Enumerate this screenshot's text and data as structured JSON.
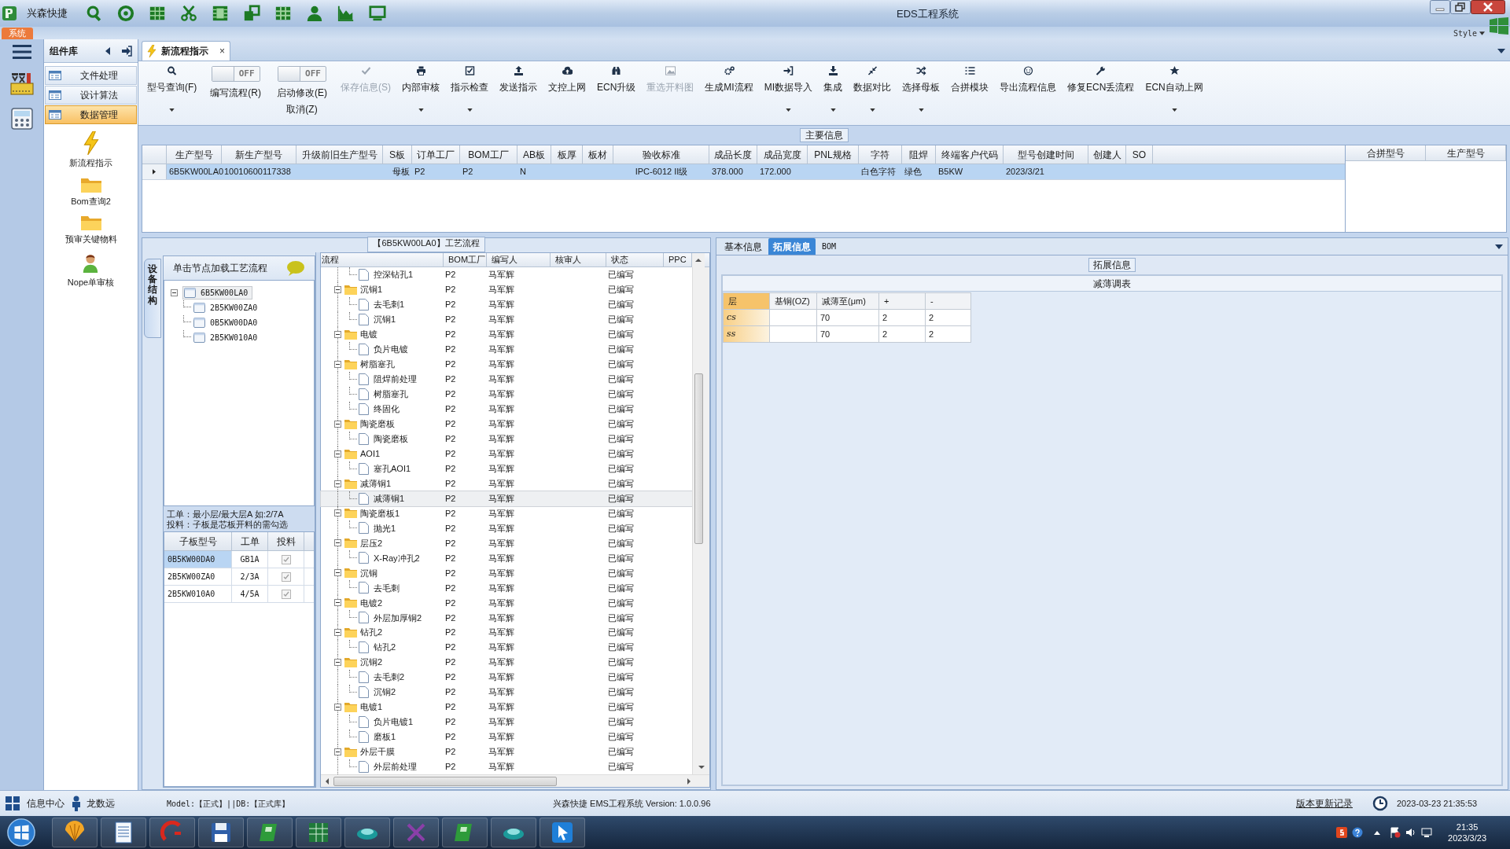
{
  "window": {
    "app_name": "兴森快捷",
    "title": "EDS工程系统",
    "ribbon_tab": "系统",
    "style_menu": "Style"
  },
  "sidebar": {
    "title": "组件库",
    "items": [
      {
        "label": "文件处理",
        "selected": false
      },
      {
        "label": "设计算法",
        "selected": false
      },
      {
        "label": "数据管理",
        "selected": true
      }
    ],
    "launchers": [
      {
        "label": "新流程指示",
        "kind": "lightning"
      },
      {
        "label": "Bom查询2",
        "kind": "folder"
      },
      {
        "label": "预审关键物料",
        "kind": "folder"
      },
      {
        "label": "Nope单审核",
        "kind": "person"
      }
    ]
  },
  "document_tabs": [
    {
      "label": "新流程指示",
      "close": "×",
      "selected": true
    }
  ],
  "toolbar": [
    {
      "kind": "button",
      "label": "型号查询(F)",
      "disabled": false,
      "dropdown": true
    },
    {
      "kind": "toggle",
      "label": "编写流程(R)",
      "toggle_text": "OFF",
      "on": false
    },
    {
      "kind": "toggle",
      "label": "启动修改(E)",
      "label_2": "取消(Z)",
      "toggle_text": "OFF",
      "on": false
    },
    {
      "kind": "button",
      "label": "保存信息(S)",
      "disabled": true,
      "dropdown": false
    },
    {
      "kind": "button",
      "label": "内部审核",
      "disabled": false,
      "dropdown": true
    },
    {
      "kind": "button",
      "label": "指示检查",
      "disabled": false,
      "dropdown": true
    },
    {
      "kind": "button",
      "label": "发送指示",
      "disabled": false,
      "dropdown": false
    },
    {
      "kind": "button",
      "label": "文控上网",
      "disabled": false,
      "dropdown": false
    },
    {
      "kind": "button",
      "label": "ECN升级",
      "disabled": false,
      "dropdown": false
    },
    {
      "kind": "button",
      "label": "重选开料图",
      "disabled": true,
      "dropdown": false
    },
    {
      "kind": "button",
      "label": "生成MI流程",
      "disabled": false,
      "dropdown": false
    },
    {
      "kind": "button",
      "label": "MI数据导入",
      "disabled": false,
      "dropdown": true
    },
    {
      "kind": "button",
      "label": "集成",
      "disabled": false,
      "dropdown": true
    },
    {
      "kind": "button",
      "label": "数据对比",
      "disabled": false,
      "dropdown": true
    },
    {
      "kind": "button",
      "label": "选择母板",
      "disabled": false,
      "dropdown": true
    },
    {
      "kind": "button",
      "label": "合拼模块",
      "disabled": false,
      "dropdown": false
    },
    {
      "kind": "button",
      "label": "导出流程信息",
      "disabled": false,
      "dropdown": false
    },
    {
      "kind": "button",
      "label": "修复ECN丢流程",
      "disabled": false,
      "dropdown": false
    },
    {
      "kind": "button",
      "label": "ECN自动上网",
      "disabled": false,
      "dropdown": true
    }
  ],
  "main_info": {
    "title": "主要信息",
    "columns": [
      "生产型号",
      "新生产型号",
      "升级前旧生产型号",
      "S板",
      "订单工厂",
      "BOM工厂",
      "AB板",
      "板厚",
      "板材",
      "验收标准",
      "成品长度",
      "成品宽度",
      "PNL规格",
      "字符",
      "阻焊",
      "终端客户代码",
      "型号创建时间",
      "创建人",
      "SO"
    ],
    "rows": [
      {
        "selected": true,
        "cells": [
          "6B5KW00LA0",
          "10010600117338",
          null,
          "母板",
          "P2",
          "P2",
          "N",
          null,
          null,
          "IPC-6012 II级",
          "378.000",
          "172.000",
          null,
          "白色字符",
          "绿色",
          "B5KW",
          "2023/3/21",
          null,
          null
        ]
      }
    ]
  },
  "merge_table": {
    "columns": [
      "合拼型号",
      "生产型号"
    ]
  },
  "process_panel": {
    "title": "【6B5KW00LA0】工艺流程",
    "side_tab": "设备结构",
    "tree_hint": "单击节点加载工艺流程",
    "tree": [
      {
        "label": "6B5KW00LA0",
        "expanded": true,
        "selected": true,
        "children": [
          {
            "label": "2B5KW00ZA0",
            "selected": false
          },
          {
            "label": "0B5KW00DA0",
            "selected": false
          },
          {
            "label": "2B5KW010A0",
            "selected": false
          }
        ]
      }
    ],
    "note": [
      "工单：最小层/最大层A 如:2/7A",
      "投料：子板是芯板开料的需勾选"
    ],
    "sub_boards": {
      "columns": [
        "子板型号",
        "工单",
        "投料"
      ],
      "rows": [
        {
          "board": "0B5KW00DA0",
          "order": "GB1A",
          "feed": true,
          "selected": true
        },
        {
          "board": "2B5KW00ZA0",
          "order": "2/3A",
          "feed": true,
          "selected": false
        },
        {
          "board": "2B5KW010A0",
          "order": "4/5A",
          "feed": true,
          "selected": false
        }
      ]
    },
    "flow": {
      "columns": [
        "流程",
        "BOM工厂",
        "编写人",
        "核审人",
        "状态",
        "PPC"
      ],
      "rows": [
        {
          "children": [
            {
              "name": "控深钻孔1",
              "bom_factory": "P2",
              "writer": "马军辉",
              "status": "已编写",
              "selected": false
            }
          ]
        },
        {
          "name": "沉铜1",
          "bom_factory": "P2",
          "writer": "马军辉",
          "status": "已编写",
          "expanded": true,
          "selected": false,
          "children": [
            {
              "name": "去毛刺1",
              "bom_factory": "P2",
              "writer": "马军辉",
              "status": "已编写",
              "selected": false
            },
            {
              "name": "沉铜1",
              "bom_factory": "P2",
              "writer": "马军辉",
              "status": "已编写",
              "selected": false
            }
          ]
        },
        {
          "name": "电镀",
          "bom_factory": "P2",
          "writer": "马军辉",
          "status": "已编写",
          "expanded": true,
          "selected": false,
          "children": [
            {
              "name": "负片电镀",
              "bom_factory": "P2",
              "writer": "马军辉",
              "status": "已编写",
              "selected": false
            }
          ]
        },
        {
          "name": "树脂塞孔",
          "bom_factory": "P2",
          "writer": "马军辉",
          "status": "已编写",
          "expanded": true,
          "selected": false,
          "children": [
            {
              "name": "阻焊前处理",
              "bom_factory": "P2",
              "writer": "马军辉",
              "status": "已编写",
              "selected": false
            },
            {
              "name": "树脂塞孔",
              "bom_factory": "P2",
              "writer": "马军辉",
              "status": "已编写",
              "selected": false
            },
            {
              "name": "终固化",
              "bom_factory": "P2",
              "writer": "马军辉",
              "status": "已编写",
              "selected": false
            }
          ]
        },
        {
          "name": "陶瓷磨板",
          "bom_factory": "P2",
          "writer": "马军辉",
          "status": "已编写",
          "expanded": true,
          "selected": false,
          "children": [
            {
              "name": "陶瓷磨板",
              "bom_factory": "P2",
              "writer": "马军辉",
              "status": "已编写",
              "selected": false
            }
          ]
        },
        {
          "name": "AOI1",
          "bom_factory": "P2",
          "writer": "马军辉",
          "status": "已编写",
          "expanded": true,
          "selected": false,
          "children": [
            {
              "name": "塞孔AOI1",
              "bom_factory": "P2",
              "writer": "马军辉",
              "status": "已编写",
              "selected": false
            }
          ]
        },
        {
          "name": "减薄铜1",
          "bom_factory": "P2",
          "writer": "马军辉",
          "status": "已编写",
          "expanded": true,
          "selected": false,
          "children": [
            {
              "name": "减薄铜1",
              "bom_factory": "P2",
              "writer": "马军辉",
              "status": "已编写",
              "selected": true
            }
          ]
        },
        {
          "name": "陶瓷磨板1",
          "bom_factory": "P2",
          "writer": "马军辉",
          "status": "已编写",
          "expanded": true,
          "selected": false,
          "children": [
            {
              "name": "抛光1",
              "bom_factory": "P2",
              "writer": "马军辉",
              "status": "已编写",
              "selected": false
            }
          ]
        },
        {
          "name": "层压2",
          "bom_factory": "P2",
          "writer": "马军辉",
          "status": "已编写",
          "expanded": true,
          "selected": false,
          "children": [
            {
              "name": "X-Ray冲孔2",
              "bom_factory": "P2",
              "writer": "马军辉",
              "status": "已编写",
              "selected": false
            }
          ]
        },
        {
          "name": "沉铜",
          "bom_factory": "P2",
          "writer": "马军辉",
          "status": "已编写",
          "expanded": true,
          "selected": false,
          "children": [
            {
              "name": "去毛刺",
              "bom_factory": "P2",
              "writer": "马军辉",
              "status": "已编写",
              "selected": false
            }
          ]
        },
        {
          "name": "电镀2",
          "bom_factory": "P2",
          "writer": "马军辉",
          "status": "已编写",
          "expanded": true,
          "selected": false,
          "children": [
            {
              "name": "外层加厚铜2",
              "bom_factory": "P2",
              "writer": "马军辉",
              "status": "已编写",
              "selected": false
            }
          ]
        },
        {
          "name": "钻孔2",
          "bom_factory": "P2",
          "writer": "马军辉",
          "status": "已编写",
          "expanded": true,
          "selected": false,
          "children": [
            {
              "name": "钻孔2",
              "bom_factory": "P2",
              "writer": "马军辉",
              "status": "已编写",
              "selected": false
            }
          ]
        },
        {
          "name": "沉铜2",
          "bom_factory": "P2",
          "writer": "马军辉",
          "status": "已编写",
          "expanded": true,
          "selected": false,
          "children": [
            {
              "name": "去毛刺2",
              "bom_factory": "P2",
              "writer": "马军辉",
              "status": "已编写",
              "selected": false
            },
            {
              "name": "沉铜2",
              "bom_factory": "P2",
              "writer": "马军辉",
              "status": "已编写",
              "selected": false
            }
          ]
        },
        {
          "name": "电镀1",
          "bom_factory": "P2",
          "writer": "马军辉",
          "status": "已编写",
          "expanded": true,
          "selected": false,
          "children": [
            {
              "name": "负片电镀1",
              "bom_factory": "P2",
              "writer": "马军辉",
              "status": "已编写",
              "selected": false
            },
            {
              "name": "磨板1",
              "bom_factory": "P2",
              "writer": "马军辉",
              "status": "已编写",
              "selected": false
            }
          ]
        },
        {
          "name": "外层干膜",
          "bom_factory": "P2",
          "writer": "马军辉",
          "status": "已编写",
          "expanded": true,
          "selected": false,
          "children": [
            {
              "name": "外层前处理",
              "bom_factory": "P2",
              "writer": "马军辉",
              "status": "已编写",
              "selected": false
            }
          ]
        }
      ]
    }
  },
  "detail_panel": {
    "tabs": [
      {
        "label": "基本信息",
        "selected": false
      },
      {
        "label": "拓展信息",
        "selected": true
      },
      {
        "label": "BOM",
        "selected": false
      }
    ],
    "section": "拓展信息",
    "box_title": "减薄调表",
    "columns": [
      "层",
      "基铜(OZ)",
      "减薄至(μm)",
      "+",
      "-"
    ],
    "rows": [
      [
        "cs",
        null,
        "70",
        "2",
        "2"
      ],
      [
        "ss",
        null,
        "70",
        "2",
        "2"
      ]
    ]
  },
  "status_bar": {
    "info_center": "信息中心",
    "user": "龙数远",
    "environment": "Model:【正式】||DB:【正式库】",
    "version": "兴森快捷 EMS工程系统 Version: 1.0.0.96",
    "changelog": "版本更新记录",
    "datetime": "2023-03-23 21:35:53"
  },
  "taskbar": {
    "time": "21:35",
    "date": "2023/3/23"
  }
}
